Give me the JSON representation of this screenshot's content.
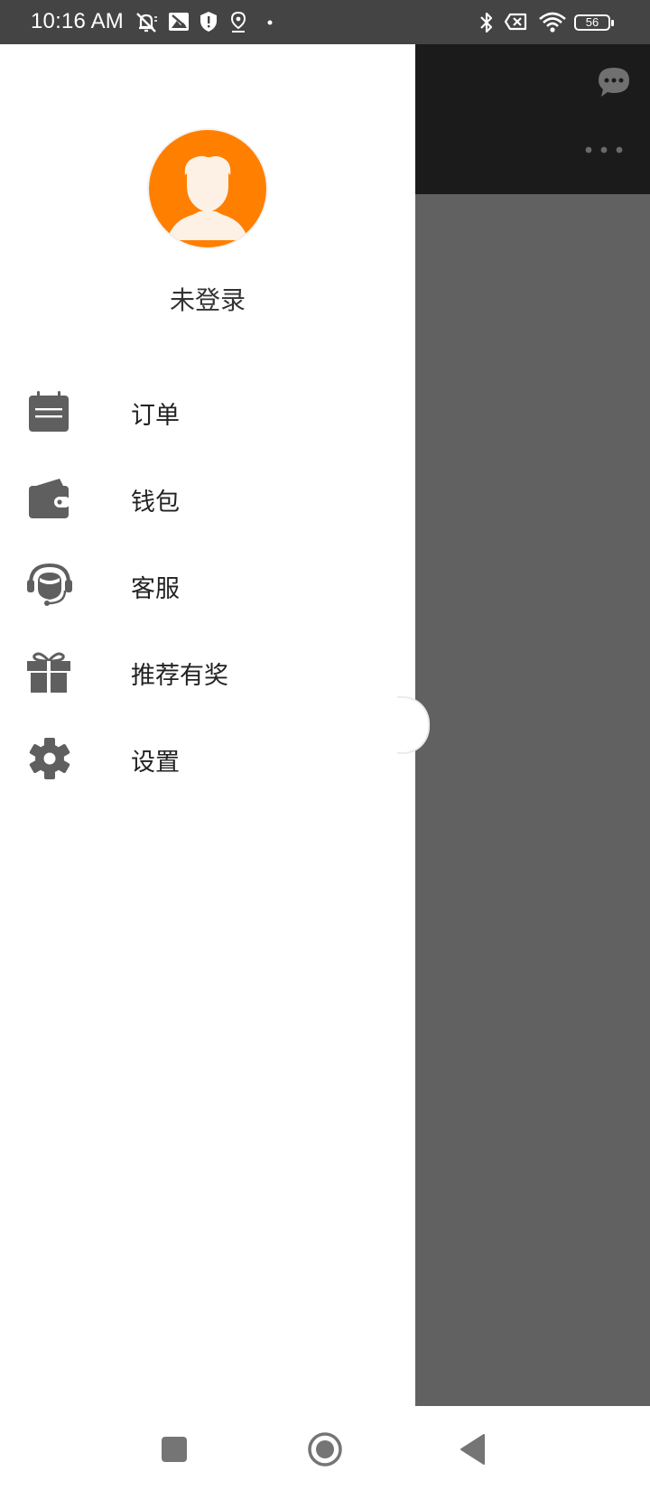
{
  "status_bar": {
    "time": "10:16 AM",
    "left_icons": [
      "mute-icon",
      "image-icon",
      "shield-icon",
      "location-icon",
      "dot-icon"
    ],
    "right_icons": [
      "bluetooth-icon",
      "x-box-icon",
      "wifi-icon",
      "battery-icon"
    ],
    "battery": "56"
  },
  "drawer": {
    "avatar_icon": "user-avatar-icon",
    "username": "未登录",
    "items": [
      {
        "label": "订单",
        "icon": "calendar-icon"
      },
      {
        "label": "钱包",
        "icon": "wallet-icon"
      },
      {
        "label": "客服",
        "icon": "headset-icon"
      },
      {
        "label": "推荐有奖",
        "icon": "gift-icon"
      },
      {
        "label": "设置",
        "icon": "gear-icon"
      }
    ]
  },
  "background_app": {
    "icons": [
      "chat-bubble-icon",
      "more-dots-icon"
    ]
  },
  "nav_bar": {
    "buttons": [
      "recents-button",
      "home-button",
      "back-button"
    ]
  },
  "colors": {
    "status_bar": "#444444",
    "avatar_bg": "#ff7f00",
    "icon_gray": "#5f5f5f",
    "overlay": "#616161",
    "app_header": "#1b1b1b"
  }
}
